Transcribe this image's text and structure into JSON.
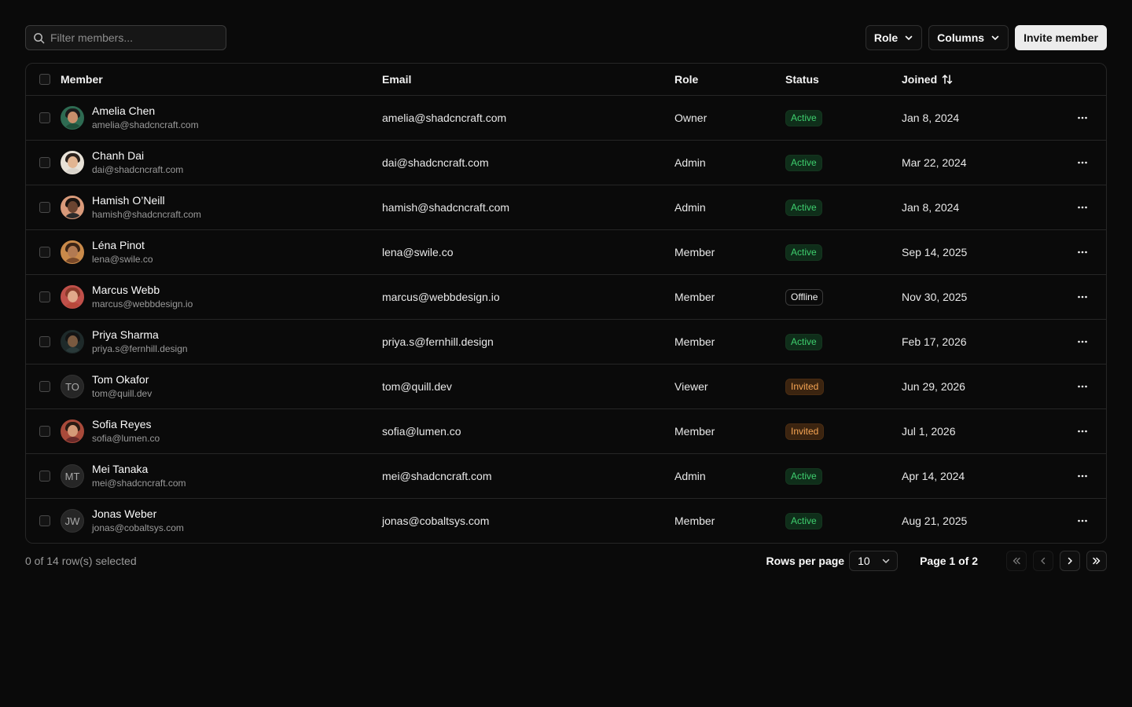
{
  "toolbar": {
    "search_placeholder": "Filter members...",
    "search_value": "",
    "role_label": "Role",
    "columns_label": "Columns",
    "invite_label": "Invite member"
  },
  "table": {
    "columns": {
      "member": "Member",
      "email": "Email",
      "role": "Role",
      "status": "Status",
      "joined": "Joined"
    },
    "rows": [
      {
        "name": "Amelia Chen",
        "sub_email": "amelia@shadcncraft.com",
        "email": "amelia@shadcncraft.com",
        "role": "Owner",
        "status": "Active",
        "status_kind": "active",
        "joined": "Jan 8, 2024",
        "initials": "",
        "photo": true,
        "skin": "#c98f6b",
        "hair": "#1b1b1b",
        "shirt": "#1f4f3a",
        "bg": "#2e6b52"
      },
      {
        "name": "Chanh Dai",
        "sub_email": "dai@shadcncraft.com",
        "email": "dai@shadcncraft.com",
        "role": "Admin",
        "status": "Active",
        "status_kind": "active",
        "joined": "Mar 22, 2024",
        "initials": "",
        "photo": true,
        "skin": "#e2b592",
        "hair": "#2a211c",
        "shirt": "#d9d4cc",
        "bg": "#e8e2d8"
      },
      {
        "name": "Hamish O’Neill",
        "sub_email": "hamish@shadcncraft.com",
        "email": "hamish@shadcncraft.com",
        "role": "Admin",
        "status": "Active",
        "status_kind": "active",
        "joined": "Jan 8, 2024",
        "initials": "",
        "photo": true,
        "skin": "#6b4430",
        "hair": "#1a1410",
        "shirt": "#2b2b2b",
        "bg": "#d99a7a"
      },
      {
        "name": "Léna Pinot",
        "sub_email": "lena@swile.co",
        "email": "lena@swile.co",
        "role": "Member",
        "status": "Active",
        "status_kind": "active",
        "joined": "Sep 14, 2025",
        "initials": "",
        "photo": true,
        "skin": "#b27a52",
        "hair": "#3a2416",
        "shirt": "#7a4a2a",
        "bg": "#c98a4a"
      },
      {
        "name": "Marcus Webb",
        "sub_email": "marcus@webbdesign.io",
        "email": "marcus@webbdesign.io",
        "role": "Member",
        "status": "Offline",
        "status_kind": "offline",
        "joined": "Nov 30, 2025",
        "initials": "",
        "photo": true,
        "skin": "#e0a88a",
        "hair": "#8a3a2a",
        "shirt": "#b8483a",
        "bg": "#c0504a"
      },
      {
        "name": "Priya Sharma",
        "sub_email": "priya.s@fernhill.design",
        "email": "priya.s@fernhill.design",
        "role": "Member",
        "status": "Active",
        "status_kind": "active",
        "joined": "Feb 17, 2026",
        "initials": "",
        "photo": true,
        "skin": "#7a5a40",
        "hair": "#141414",
        "shirt": "#2a3a3a",
        "bg": "#1e2a2a"
      },
      {
        "name": "Tom Okafor",
        "sub_email": "tom@quill.dev",
        "email": "tom@quill.dev",
        "role": "Viewer",
        "status": "Invited",
        "status_kind": "invited",
        "joined": "Jun 29, 2026",
        "initials": "TO",
        "photo": false
      },
      {
        "name": "Sofia Reyes",
        "sub_email": "sofia@lumen.co",
        "email": "sofia@lumen.co",
        "role": "Member",
        "status": "Invited",
        "status_kind": "invited",
        "joined": "Jul 1, 2026",
        "initials": "",
        "photo": true,
        "skin": "#d49a78",
        "hair": "#2a1a12",
        "shirt": "#6a2a2a",
        "bg": "#a84a3a"
      },
      {
        "name": "Mei Tanaka",
        "sub_email": "mei@shadcncraft.com",
        "email": "mei@shadcncraft.com",
        "role": "Admin",
        "status": "Active",
        "status_kind": "active",
        "joined": "Apr 14, 2024",
        "initials": "MT",
        "photo": false
      },
      {
        "name": "Jonas Weber",
        "sub_email": "jonas@cobaltsys.com",
        "email": "jonas@cobaltsys.com",
        "role": "Member",
        "status": "Active",
        "status_kind": "active",
        "joined": "Aug 21, 2025",
        "initials": "JW",
        "photo": false
      }
    ]
  },
  "footer": {
    "selection_text": "0 of 14 row(s) selected",
    "rows_per_page_label": "Rows per page",
    "rows_per_page_value": "10",
    "page_text": "Page 1 of 2"
  },
  "colors": {
    "background": "#0a0a0a",
    "active_text": "#3ecf6e",
    "invited_text": "#f5a453",
    "primary_button": "#ececec"
  }
}
